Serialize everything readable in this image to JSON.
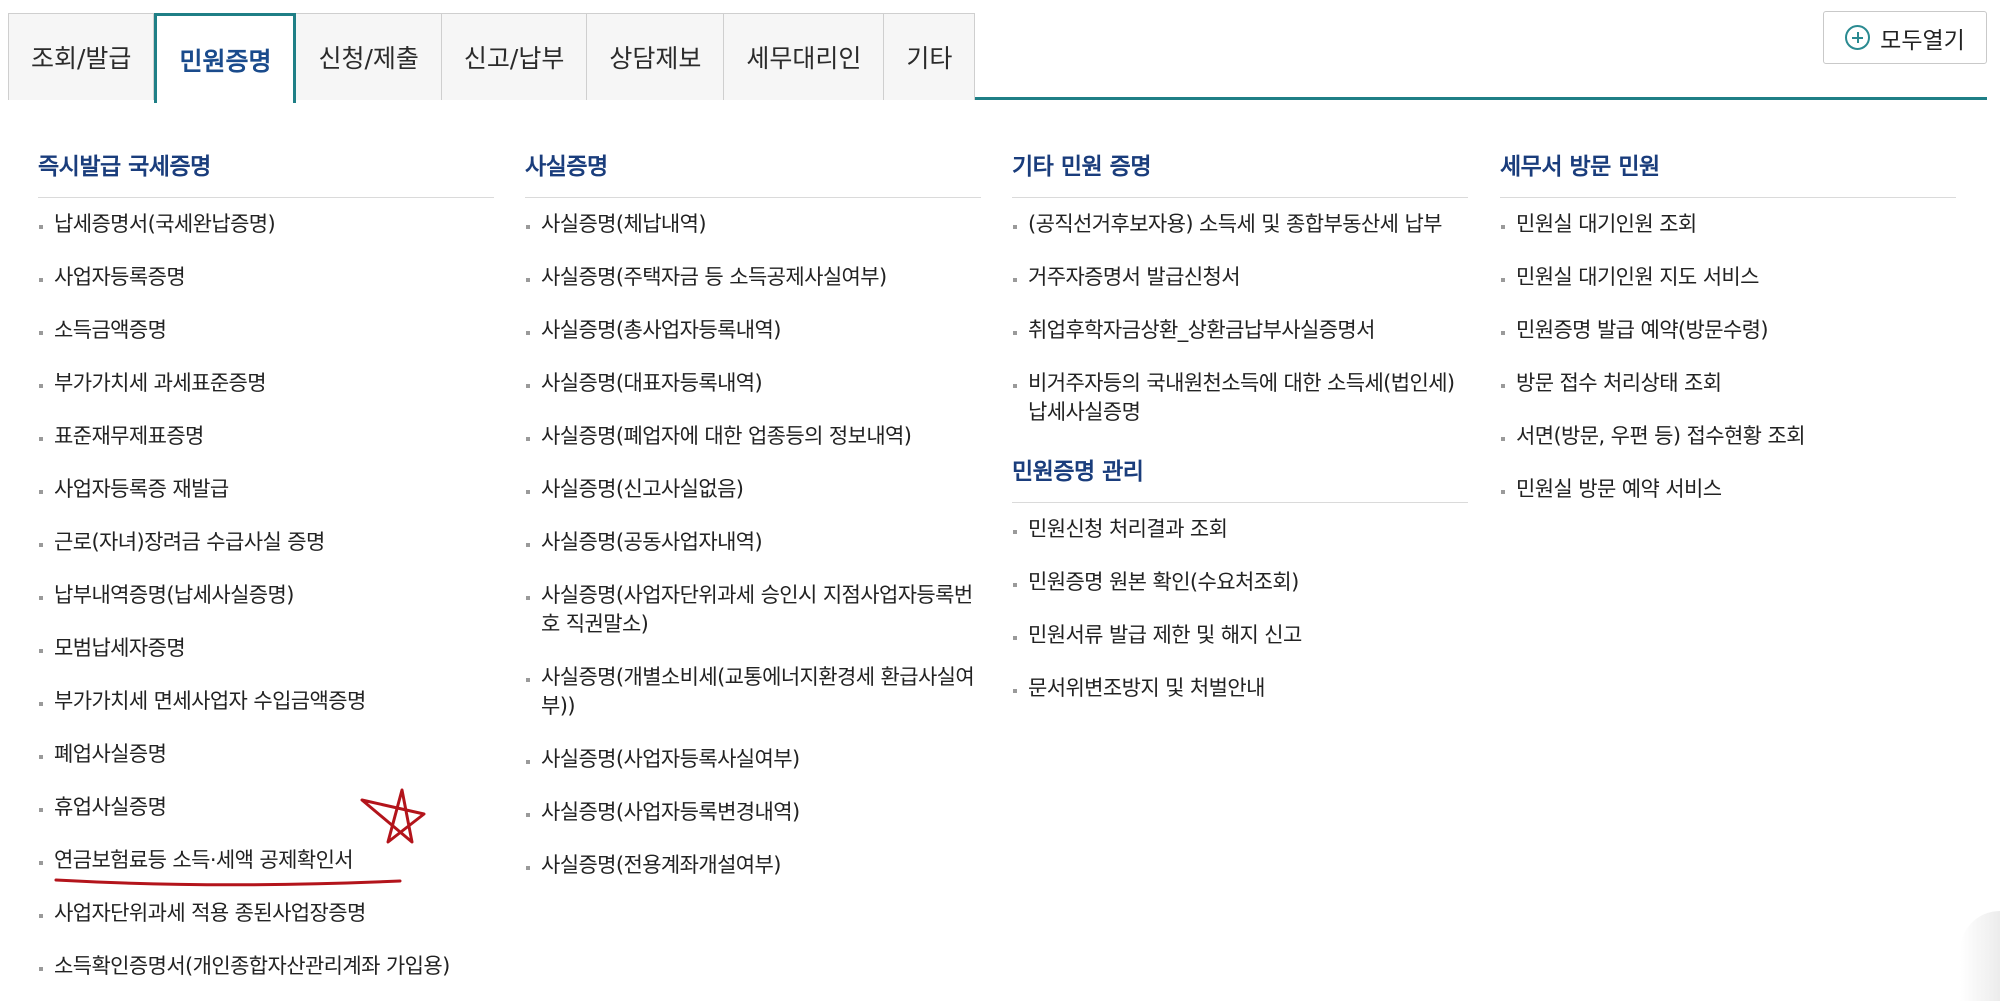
{
  "tabs": [
    {
      "label": "조회/발급",
      "active": false
    },
    {
      "label": "민원증명",
      "active": true
    },
    {
      "label": "신청/제출",
      "active": false
    },
    {
      "label": "신고/납부",
      "active": false
    },
    {
      "label": "상담제보",
      "active": false
    },
    {
      "label": "세무대리인",
      "active": false
    },
    {
      "label": "기타",
      "active": false
    }
  ],
  "expand_all": {
    "label": "모두열기",
    "icon": "plus-circle-icon"
  },
  "columns": [
    {
      "title": "즉시발급 국세증명",
      "items": [
        "납세증명서(국세완납증명)",
        "사업자등록증명",
        "소득금액증명",
        "부가가치세 과세표준증명",
        "표준재무제표증명",
        "사업자등록증 재발급",
        "근로(자녀)장려금 수급사실 증명",
        "납부내역증명(납세사실증명)",
        "모범납세자증명",
        "부가가치세 면세사업자 수입금액증명",
        "폐업사실증명",
        "휴업사실증명",
        "연금보험료등 소득·세액 공제확인서",
        "사업자단위과세 적용 종된사업장증명",
        "소득확인증명서(개인종합자산관리계좌 가입용)"
      ]
    },
    {
      "title": "사실증명",
      "items": [
        "사실증명(체납내역)",
        "사실증명(주택자금 등 소득공제사실여부)",
        "사실증명(총사업자등록내역)",
        "사실증명(대표자등록내역)",
        "사실증명(폐업자에 대한 업종등의 정보내역)",
        "사실증명(신고사실없음)",
        "사실증명(공동사업자내역)",
        "사실증명(사업자단위과세 승인시 지점사업자등록번호 직권말소)",
        "사실증명(개별소비세(교통에너지환경세 환급사실여부))",
        "사실증명(사업자등록사실여부)",
        "사실증명(사업자등록변경내역)",
        "사실증명(전용계좌개설여부)"
      ]
    },
    {
      "title": "기타 민원 증명",
      "items": [
        "(공직선거후보자용) 소득세 및 종합부동산세 납부",
        "거주자증명서 발급신청서",
        "취업후학자금상환_상환금납부사실증명서",
        "비거주자등의 국내원천소득에 대한 소득세(법인세) 납세사실증명"
      ],
      "sub_title": "민원증명 관리",
      "sub_items": [
        "민원신청 처리결과 조회",
        "민원증명 원본 확인(수요처조회)",
        "민원서류 발급 제한 및 해지 신고",
        "문서위변조방지 및 처벌안내"
      ]
    },
    {
      "title": "세무서 방문 민원",
      "items": [
        "민원실 대기인원 조회",
        "민원실 대기인원 지도 서비스",
        "민원증명 발급 예약(방문수령)",
        "방문 접수 처리상태 조회",
        "서면(방문, 우편 등) 접수현황 조회",
        "민원실 방문 예약 서비스"
      ]
    }
  ],
  "colors": {
    "accent": "#1f7f86",
    "title": "#1a3d7c",
    "annotation": "#b3141b"
  }
}
